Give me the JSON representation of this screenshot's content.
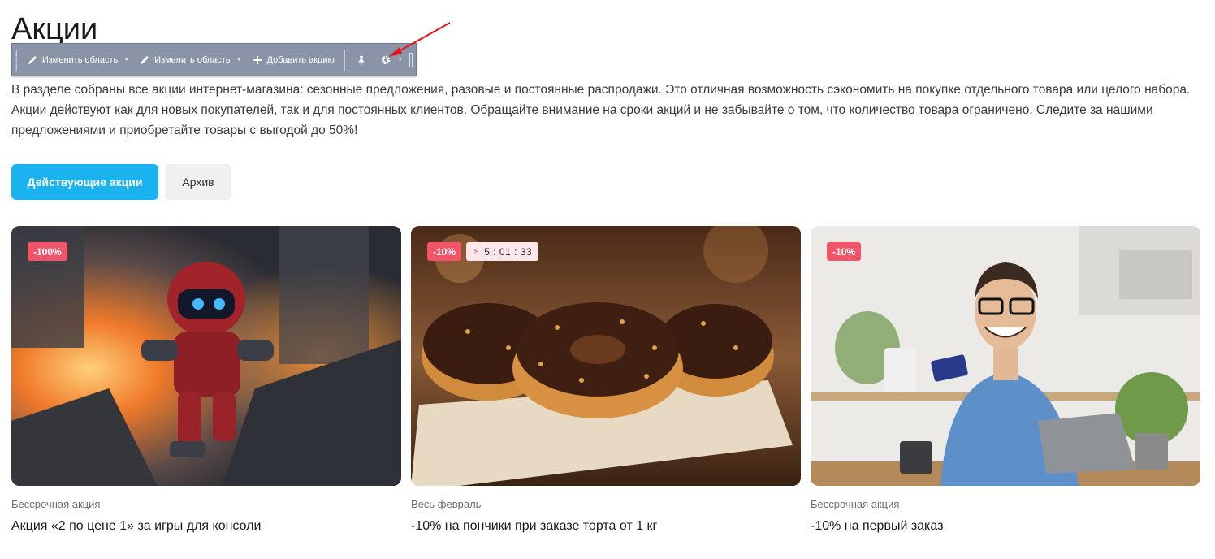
{
  "page": {
    "title": "Акции",
    "description": "В разделе собраны все акции интернет-магазина: сезонные предложения, разовые и постоянные распродажи. Это отличная возможность сэкономить на покупке отдельного товара или целого набора. Акции действуют как для новых покупателей, так и для постоянных клиентов. Обращайте внимание на сроки акций и не забывайте о том, что количество товара ограничено. Следите за нашими предложениями и приобретайте товары с выгодой до 50%!"
  },
  "toolbar": {
    "edit_area_1": "Изменить область",
    "edit_area_2": "Изменить область",
    "add_promo": "Добавить акцию",
    "icons": [
      "pencil-icon",
      "pencil-icon",
      "plus-icon",
      "pin-icon",
      "gear-icon"
    ]
  },
  "tabs": {
    "active": "Действующие акции",
    "archive": "Архив"
  },
  "cards": [
    {
      "badge": "-100%",
      "period": "Бессрочная акция",
      "name": "Акция «2 по цене 1» за игры для консоли",
      "image": "robot-explosion-image"
    },
    {
      "badge": "-10%",
      "timer": "5 : 01 : 33",
      "period": "Весь февраль",
      "name": "-10% на пончики при заказе торта от 1 кг",
      "image": "chocolate-donuts-image"
    },
    {
      "badge": "-10%",
      "period": "Бессрочная акция",
      "name": "-10% на первый заказ",
      "image": "man-with-card-laptop-image"
    }
  ],
  "colors": {
    "accent": "#1ab2ef",
    "badge": "#f2556a",
    "toolbar": "#8a94a6"
  }
}
